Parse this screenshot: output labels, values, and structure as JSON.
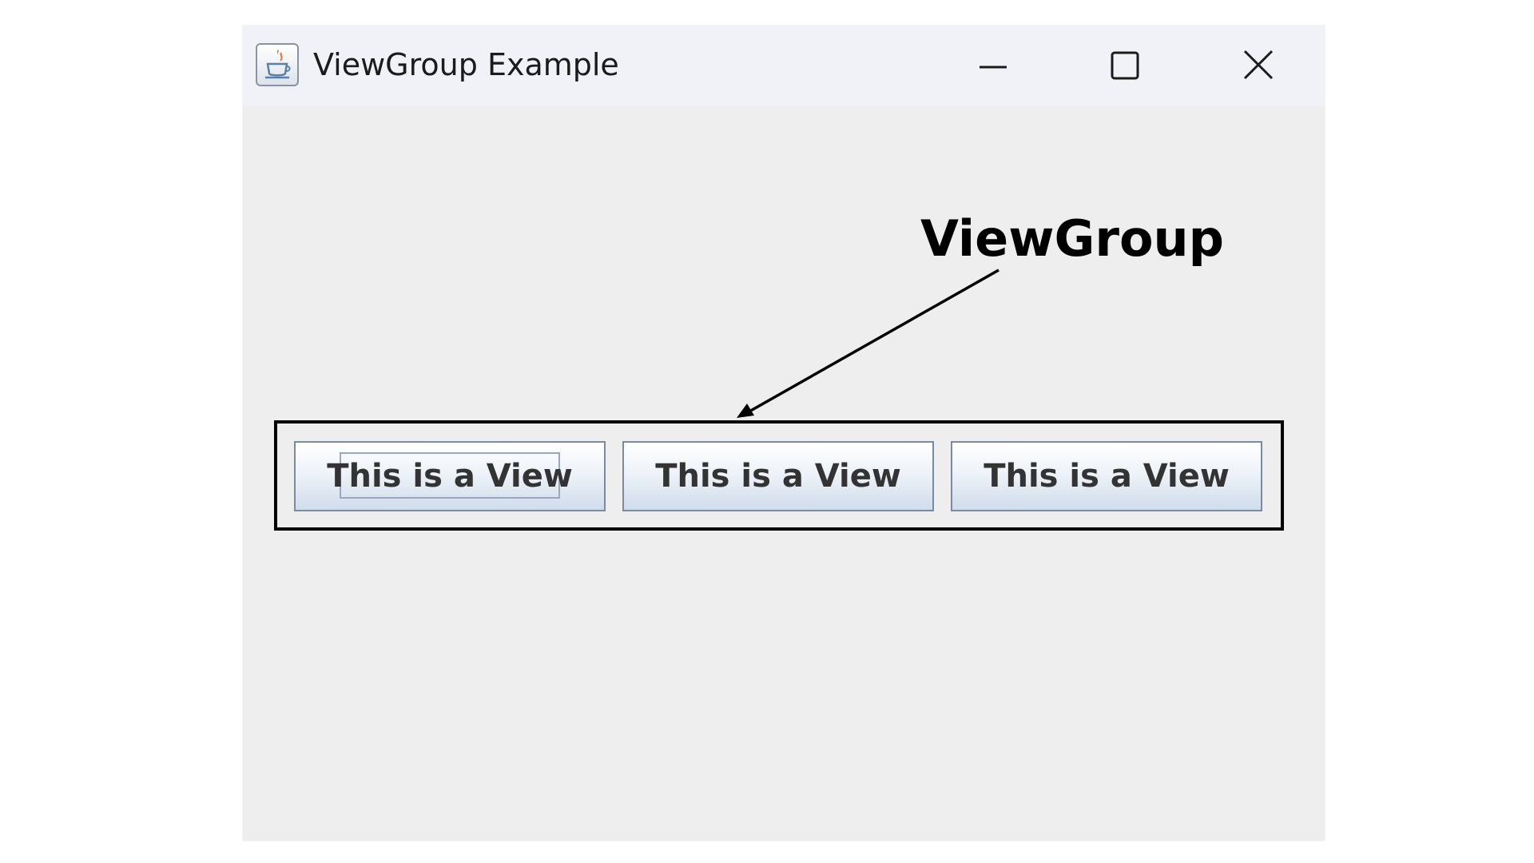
{
  "window": {
    "title": "ViewGroup Example",
    "icon": "java-coffee-cup-icon",
    "controls": {
      "minimize_icon": "minimize-icon",
      "maximize_icon": "maximize-icon",
      "close_icon": "close-icon"
    }
  },
  "annotation": {
    "label": "ViewGroup"
  },
  "viewgroup": {
    "buttons": [
      {
        "label": "This is a View",
        "focused": true
      },
      {
        "label": "This is a View",
        "focused": false
      },
      {
        "label": "This is a View",
        "focused": false
      }
    ]
  },
  "colors": {
    "window_background": "#eeeeee",
    "titlebar_background": "#f0f2f7",
    "button_border": "#7a8aa0",
    "button_text": "#333333"
  }
}
